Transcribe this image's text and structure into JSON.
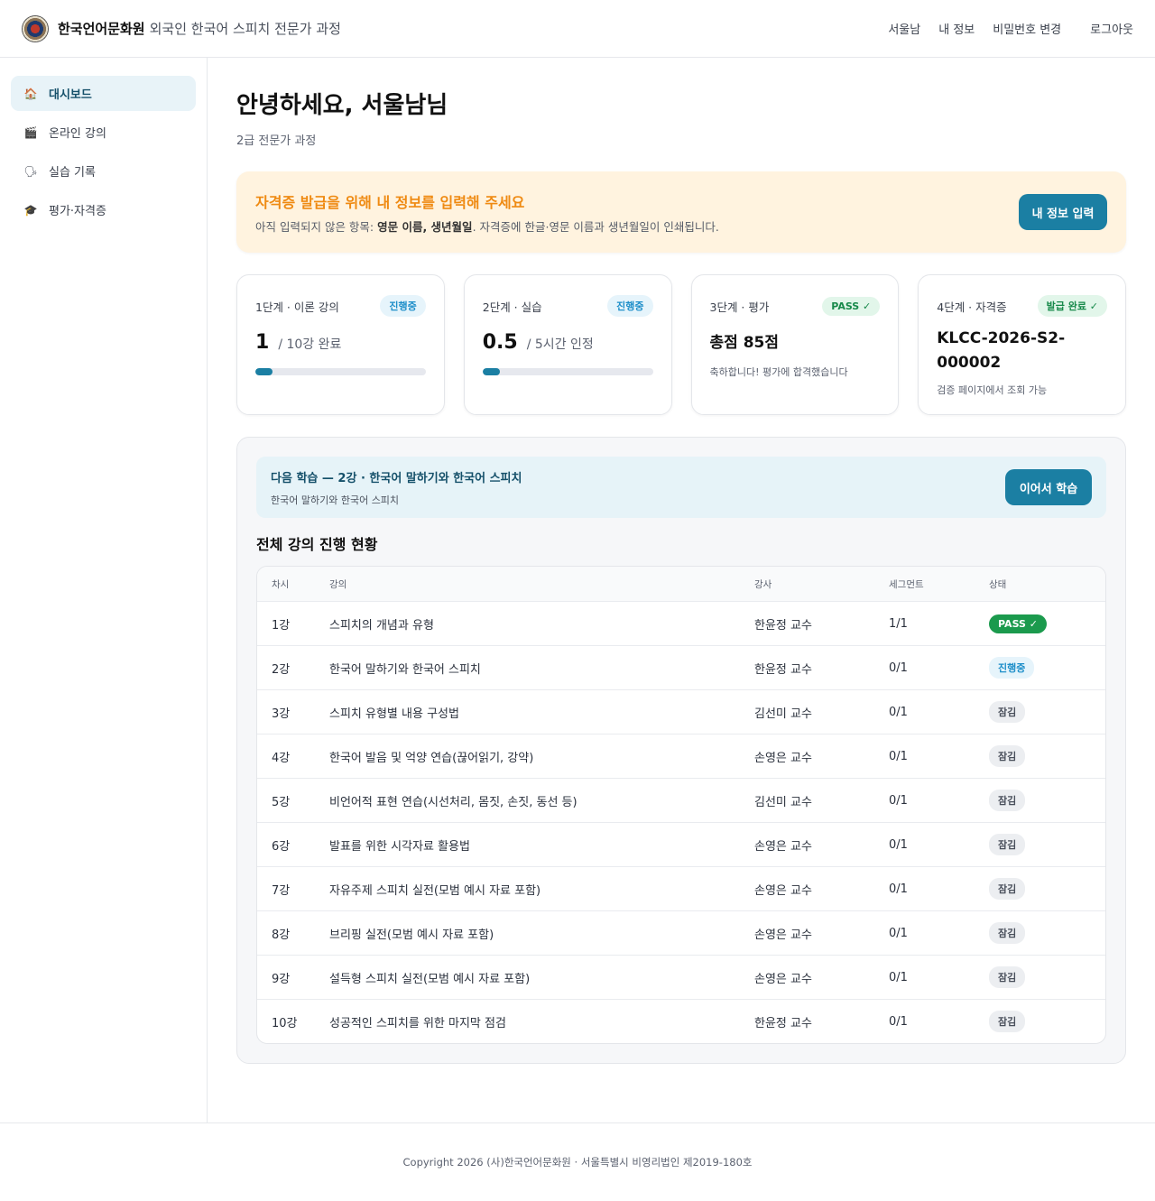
{
  "header": {
    "brand": "한국언어문화원",
    "course": "외국인 한국어 스피치 전문가 과정",
    "nav": {
      "user": "서울남",
      "my_info": "내 정보",
      "change_password": "비밀번호 변경",
      "logout": "로그아웃"
    }
  },
  "sidebar": {
    "items": [
      {
        "label": "대시보드",
        "icon": "house-icon",
        "glyph": "🏠"
      },
      {
        "label": "온라인 강의",
        "icon": "clapperboard-icon",
        "glyph": "🎬"
      },
      {
        "label": "실습 기록",
        "icon": "speech-icon",
        "glyph": "🗣"
      },
      {
        "label": "평가·자격증",
        "icon": "graduation-cap-icon",
        "glyph": "🎓"
      }
    ]
  },
  "main": {
    "greeting": "안녕하세요, 서울남님",
    "level": "2급 전문가 과정",
    "alert": {
      "title": "자격증 발급을 위해 내 정보를 입력해 주세요",
      "prefix": "아직 입력되지 않은 항목: ",
      "missing": "영문 이름, 생년월일",
      "suffix": ". 자격증에 한글·영문 이름과 생년월일이 인쇄됩니다.",
      "button": "내 정보 입력"
    },
    "cards": [
      {
        "label": "1단계 · 이론 강의",
        "badge": "진행중",
        "value": "1",
        "unit": "/ 10강 완료",
        "progress": 0.1
      },
      {
        "label": "2단계 · 실습",
        "badge": "진행중",
        "value": "0.5",
        "unit": "/ 5시간 인정",
        "progress": 0.1
      },
      {
        "label": "3단계 · 평가",
        "badge": "PASS ✓",
        "score": "총점 85점",
        "note": "축하합니다! 평가에 합격했습니다"
      },
      {
        "label": "4단계 · 자격증",
        "badge": "발급 완료 ✓",
        "cert_line1": "KLCC-2026-S2-",
        "cert_line2": "000002",
        "note": "검증 페이지에서 조회 가능"
      }
    ],
    "next": {
      "title": "다음 학습 — 2강 · 한국어 말하기와 한국어 스피치",
      "subtitle": "한국어 말하기와 한국어 스피치",
      "button": "이어서 학습"
    },
    "table_title": "전체 강의 진행 현황",
    "table": {
      "headers": [
        "차시",
        "강의",
        "강사",
        "세그먼트",
        "상태"
      ],
      "rows": [
        [
          "1강",
          "스피치의 개념과 유형",
          "한윤정 교수",
          "1/1",
          "PASS ✓"
        ],
        [
          "2강",
          "한국어 말하기와 한국어 스피치",
          "한윤정 교수",
          "0/1",
          "진행중"
        ],
        [
          "3강",
          "스피치 유형별 내용 구성법",
          "김선미 교수",
          "0/1",
          "잠김"
        ],
        [
          "4강",
          "한국어 발음 및 억양 연습(끊어읽기, 강약)",
          "손영은 교수",
          "0/1",
          "잠김"
        ],
        [
          "5강",
          "비언어적 표현 연습(시선처리, 몸짓, 손짓, 동선 등)",
          "김선미 교수",
          "0/1",
          "잠김"
        ],
        [
          "6강",
          "발표를 위한 시각자료 활용법",
          "손영은 교수",
          "0/1",
          "잠김"
        ],
        [
          "7강",
          "자유주제 스피치 실전(모범 예시 자료 포함)",
          "손영은 교수",
          "0/1",
          "잠김"
        ],
        [
          "8강",
          "브리핑 실전(모범 예시 자료 포함)",
          "손영은 교수",
          "0/1",
          "잠김"
        ],
        [
          "9강",
          "설득형 스피치 실전(모범 예시 자료 포함)",
          "손영은 교수",
          "0/1",
          "잠김"
        ],
        [
          "10강",
          "성공적인 스피치를 위한 마지막 점검",
          "한윤정 교수",
          "0/1",
          "잠김"
        ]
      ]
    }
  },
  "footer": {
    "text": "Copyright 2026 (사)한국언어문화원 · 서울특별시 비영리법인 제2019-180호"
  },
  "colors": {
    "accent": "#1b7fa3",
    "warning": "#ef8a12",
    "pass": "#1b9a4d",
    "progress": "#1d8ec9"
  }
}
